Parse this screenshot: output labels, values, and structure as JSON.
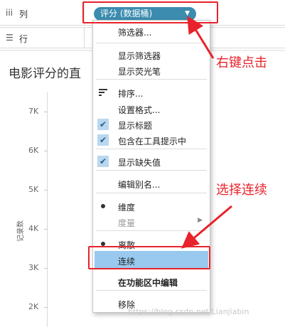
{
  "shelves": {
    "columns": {
      "icon": "columns-icon",
      "label": "列"
    },
    "rows": {
      "icon": "rows-icon",
      "label": "行"
    }
  },
  "pill": {
    "label": "评分 (数据桶)",
    "color": "#3b8caf"
  },
  "chart": {
    "title": "电影评分的直"
  },
  "chart_data": {
    "type": "bar",
    "title": "电影评分的直",
    "ylabel": "记录数",
    "yticks": [
      "7K",
      "6K",
      "5K",
      "4K",
      "3K",
      "2K"
    ],
    "ylim": [
      2000,
      7000
    ]
  },
  "context_menu": {
    "items": [
      {
        "label": "筛选器...",
        "marker": "none"
      },
      {
        "label": "显示筛选器",
        "marker": "none"
      },
      {
        "label": "显示荧光笔",
        "marker": "none"
      },
      {
        "label": "排序...",
        "marker": "sort-icon"
      },
      {
        "label": "设置格式...",
        "marker": "none"
      },
      {
        "label": "显示标题",
        "marker": "check"
      },
      {
        "label": "包含在工具提示中",
        "marker": "check"
      },
      {
        "label": "显示缺失值",
        "marker": "check"
      },
      {
        "label": "编辑别名...",
        "marker": "none"
      },
      {
        "label": "维度",
        "marker": "dot"
      },
      {
        "label": "度量",
        "marker": "submenu",
        "disabled": true
      },
      {
        "label": "离散",
        "marker": "dot"
      },
      {
        "label": "连续",
        "marker": "none",
        "highlight": true
      },
      {
        "label": "在功能区中编辑",
        "marker": "none",
        "bold": true
      },
      {
        "label": "移除",
        "marker": "none"
      }
    ]
  },
  "annotations": {
    "right_click": "右键点击",
    "choose_continuous": "选择连续",
    "color": "#e8232b"
  },
  "watermark": "https://blog.csdn.net/Lianjiabin"
}
